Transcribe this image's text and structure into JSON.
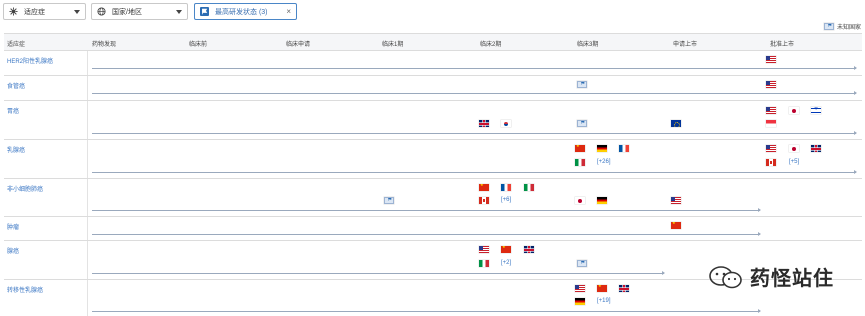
{
  "filters": {
    "indication": "适应症",
    "region": "国家/地区",
    "status": "最高研发状态 (3)"
  },
  "legend": {
    "unknown_country": "未知国家"
  },
  "table": {
    "columns": [
      "适应症",
      "药物发现",
      "临床前",
      "临床申请",
      "临床1期",
      "临床2期",
      "临床3期",
      "申请上市",
      "批准上市"
    ],
    "rows": [
      {
        "name": "HER2阳性乳腺癌",
        "more": []
      },
      {
        "name": "食管癌",
        "more": []
      },
      {
        "name": "胃癌",
        "more": []
      },
      {
        "name": "乳腺癌",
        "more": [
          "[+26]",
          "[+5]"
        ]
      },
      {
        "name": "非小细胞肺癌",
        "more": [
          "[+6]"
        ]
      },
      {
        "name": "肿瘤",
        "more": []
      },
      {
        "name": "腺癌",
        "more": [
          "[+2]"
        ]
      },
      {
        "name": "转移性乳腺癌",
        "more": [
          "[+19]"
        ]
      }
    ]
  },
  "icons": {
    "indication_filter": "virus-icon",
    "region_filter": "globe-icon",
    "status_filter": "flag-icon",
    "unknown": "flag-icon"
  },
  "flags": {
    "row1": [
      "us"
    ],
    "row2": [
      "unknown",
      "us"
    ],
    "row3": [
      "gb",
      "kr",
      "unknown",
      "eu",
      "us",
      "jp",
      "il",
      "sg"
    ],
    "row4": [
      "cn",
      "de",
      "fr",
      "it",
      "us",
      "jp",
      "gb",
      "ca"
    ],
    "row5": [
      "cn",
      "fr",
      "it",
      "ca",
      "unknown",
      "jp",
      "de",
      "us"
    ],
    "row6": [
      "cn"
    ],
    "row7": [
      "us",
      "cn",
      "gb",
      "it",
      "unknown"
    ],
    "row8": [
      "us",
      "cn",
      "gb",
      "de"
    ]
  },
  "watermark": "药怪站住",
  "colors": {
    "accent": "#3b77c4",
    "header_bg": "#f5f6f8",
    "border": "#dcdcdc"
  }
}
